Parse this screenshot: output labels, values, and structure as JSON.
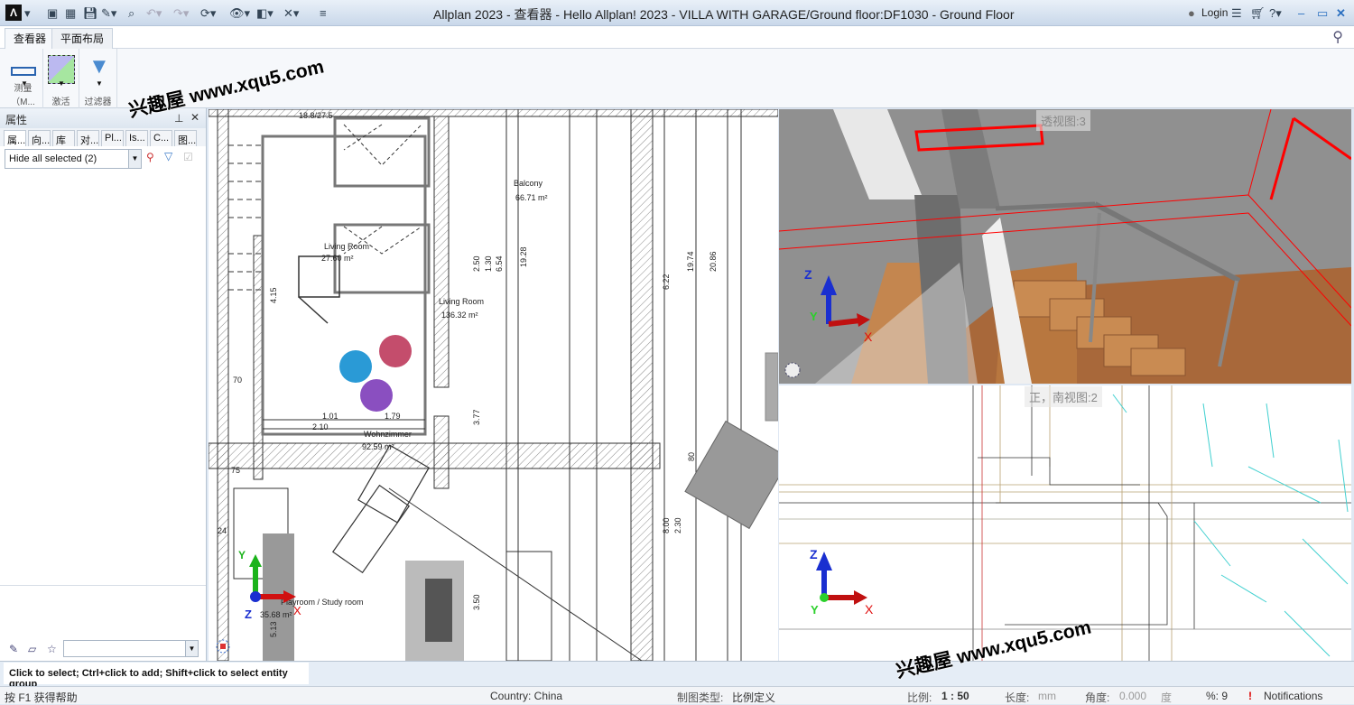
{
  "app": {
    "title": "Allplan 2023 - 查看器 - Hello Allplan! 2023 - VILLA WITH GARAGE/Ground floor:DF1030 - Ground Floor",
    "logo": "Λ"
  },
  "titlebar": {
    "login": "Login",
    "icons": [
      "user-icon",
      "list-icon",
      "cart-icon",
      "help-icon",
      "minimize-icon",
      "maximize-icon",
      "close-icon"
    ]
  },
  "tabs": [
    {
      "label": "查看器",
      "active": true
    },
    {
      "label": "平面布局",
      "active": false
    }
  ],
  "ribbon": {
    "groups": [
      {
        "label": "测量（M...",
        "icon": "ruler-icon"
      },
      {
        "label": "激活",
        "icon": "activate-icon"
      },
      {
        "label": "过滤器",
        "icon": "filter-icon"
      }
    ]
  },
  "panel": {
    "title": "属性",
    "tabs": [
      "属...",
      "向...",
      "库",
      "对...",
      "Pl...",
      "Is...",
      "C...",
      "图..."
    ],
    "combo_value": "Hide all selected (2)",
    "bottom_combo_value": ""
  },
  "viewports": {
    "perspective_label": "透视图:3",
    "front_label": "正，南视图:2"
  },
  "plan": {
    "rooms": [
      {
        "name": "Balcony",
        "area": "66.71 m²"
      },
      {
        "name": "Living Room",
        "area": "27.60 m²"
      },
      {
        "name": "Living Room",
        "area": "136.32 m²"
      },
      {
        "name": "Wohnzimmer",
        "area": "92.59 m²"
      },
      {
        "name": "Playroom / Study room",
        "area": "35.68 m²"
      }
    ],
    "dims": [
      "18.8/27.5",
      "1.01",
      "1.79",
      "2.10",
      "2.50",
      "1.30",
      "6.54",
      "19.28",
      "3.77",
      "70",
      "75",
      "24",
      "4.15",
      "3.50",
      "8.00",
      "2.30",
      "80",
      "6.22",
      "19.74",
      "20.86",
      "5.13"
    ]
  },
  "axes": {
    "x": "X",
    "y": "Y",
    "z": "Z"
  },
  "prompt": "Click to select; Ctrl+click to add; Shift+click to select entity group",
  "status": {
    "help": "按 F1 获得帮助",
    "country": "Country: China",
    "drawing_type_label": "制图类型:",
    "drawing_type": "比例定义",
    "scale_label": "比例:",
    "scale": "1 : 50",
    "length_label": "长度:",
    "length_unit": "mm",
    "angle_label": "角度:",
    "angle": "0.000",
    "angle_unit": "度",
    "percent": "%: 9",
    "notifications": "Notifications"
  },
  "watermark": "兴趣屋 www.xqu5.com",
  "colors": {
    "accent": "#1a5fb4",
    "selection": "#ff0000",
    "wood": "#b8743e"
  }
}
